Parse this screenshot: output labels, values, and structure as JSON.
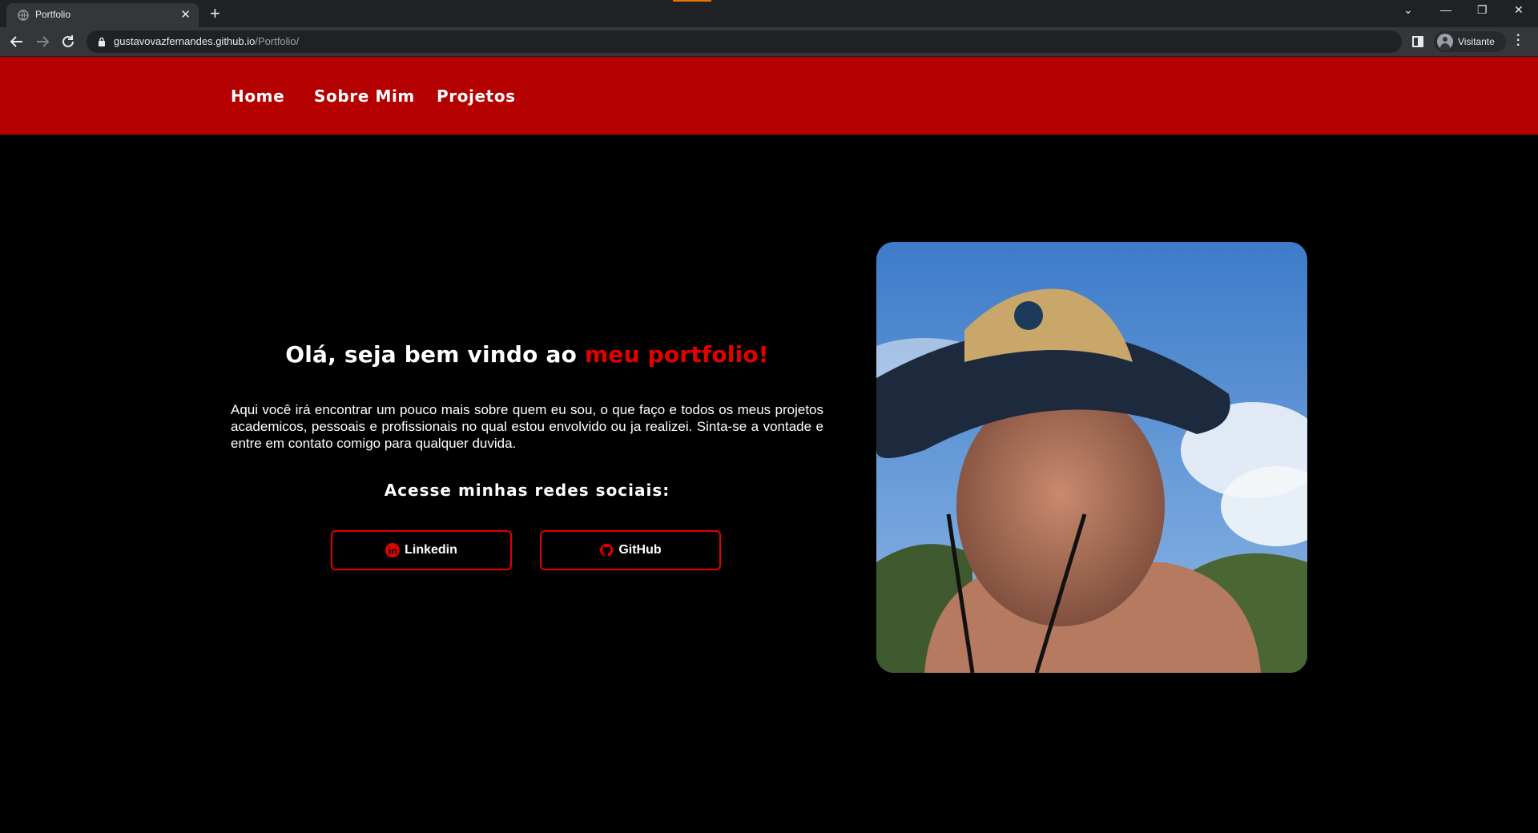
{
  "browser": {
    "tab_title": "Portfolio",
    "tab_close": "✕",
    "new_tab": "+",
    "url_host": "gustavovazfernandes.github.io",
    "url_path": "/Portfolio/",
    "profile_label": "Visitante",
    "window_controls": [
      "⌄",
      "—",
      "❐",
      "✕"
    ]
  },
  "nav": {
    "links": [
      "Home",
      "Sobre Mim",
      "Projetos"
    ]
  },
  "hero": {
    "headline_prefix": "Olá, seja bem vindo ao ",
    "headline_accent": "meu portfolio!",
    "description": "Aqui você irá encontrar um pouco mais sobre quem eu sou, o que faço e todos os meus projetos academicos, pessoais e profissionais no qual estou envolvido ou ja realizei. Sinta-se a vontade e entre em contato comigo para qualquer duvida.",
    "social_heading": "Acesse minhas redes sociais:",
    "buttons": [
      {
        "label": "Linkedin",
        "icon": "linkedin-icon"
      },
      {
        "label": "GitHub",
        "icon": "github-icon"
      }
    ]
  },
  "colors": {
    "header": "#b40000",
    "accent": "#e50000",
    "background": "#000000"
  },
  "photo": {
    "subject": "profile-photo"
  }
}
